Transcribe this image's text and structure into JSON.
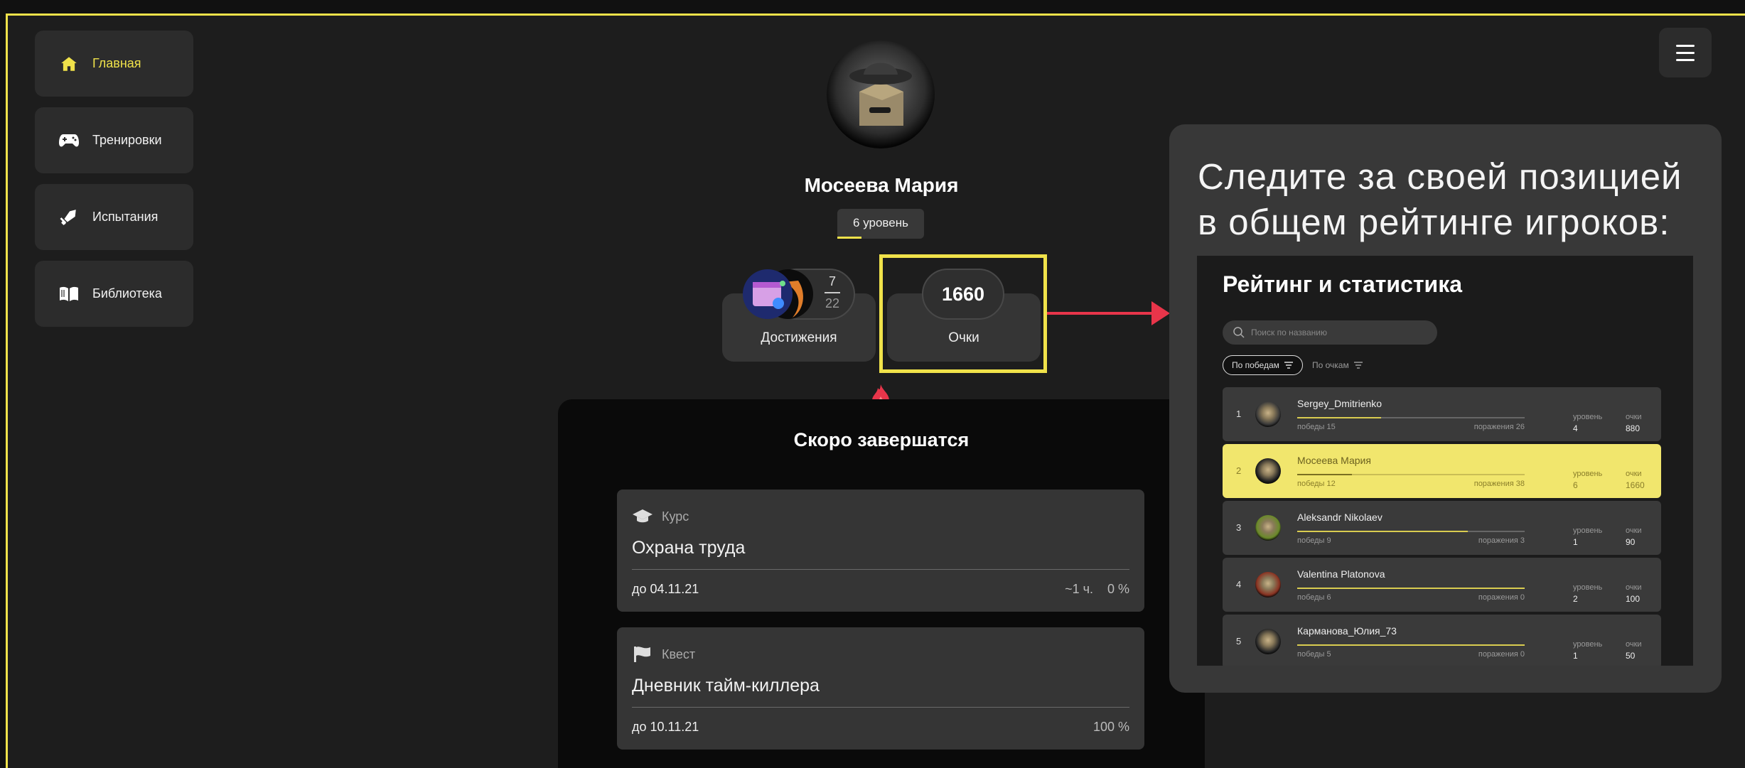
{
  "sidebar": {
    "items": [
      {
        "label": "Главная",
        "icon": "home-icon",
        "active": true
      },
      {
        "label": "Тренировки",
        "icon": "gamepad-icon",
        "active": false
      },
      {
        "label": "Испытания",
        "icon": "sword-icon",
        "active": false
      },
      {
        "label": "Библиотека",
        "icon": "book-icon",
        "active": false
      }
    ]
  },
  "profile": {
    "name": "Мосеева Мария",
    "level": "6 уровень",
    "achievements": {
      "label": "Достижения",
      "earned": "7",
      "total": "22"
    },
    "points": {
      "label": "Очки",
      "value": "1660"
    }
  },
  "soon": {
    "title": "Скоро завершатся",
    "tasks": [
      {
        "kind": "Курс",
        "title": "Охрана труда",
        "due": "до 04.11.21",
        "time": "~1 ч.",
        "progress": "0 %"
      },
      {
        "kind": "Квест",
        "title": "Дневник тайм-киллера",
        "due": "до 10.11.21",
        "progress": "100 %"
      }
    ]
  },
  "rating": {
    "caption": "Следите за своей позицией в общем рейтинге игроков:",
    "title": "Рейтинг и статистика",
    "search_placeholder": "Поиск по названию",
    "sort_wins": "По победам",
    "sort_points": "По очкам",
    "level_header": "уровень",
    "points_header": "очки",
    "rows": [
      {
        "rank": "1",
        "name": "Sergey_Dmitrienko",
        "wins": "победы 15",
        "losses": "поражения 26",
        "level": "4",
        "points": "880",
        "win_ratio": 0.37,
        "me": false
      },
      {
        "rank": "2",
        "name": "Мосеева Мария",
        "wins": "победы 12",
        "losses": "поражения 38",
        "level": "6",
        "points": "1660",
        "win_ratio": 0.24,
        "me": true
      },
      {
        "rank": "3",
        "name": "Aleksandr Nikolaev",
        "wins": "победы 9",
        "losses": "поражения 3",
        "level": "1",
        "points": "90",
        "win_ratio": 0.75,
        "me": false
      },
      {
        "rank": "4",
        "name": "Valentina Platonova",
        "wins": "победы 6",
        "losses": "поражения 0",
        "level": "2",
        "points": "100",
        "win_ratio": 1.0,
        "me": false
      },
      {
        "rank": "5",
        "name": "Карманова_Юлия_73",
        "wins": "победы 5",
        "losses": "поражения 0",
        "level": "1",
        "points": "50",
        "win_ratio": 1.0,
        "me": false
      }
    ]
  },
  "colors": {
    "accent": "#f0e24a",
    "arrow": "#e8354a",
    "highlight_row": "#f1e66d"
  }
}
